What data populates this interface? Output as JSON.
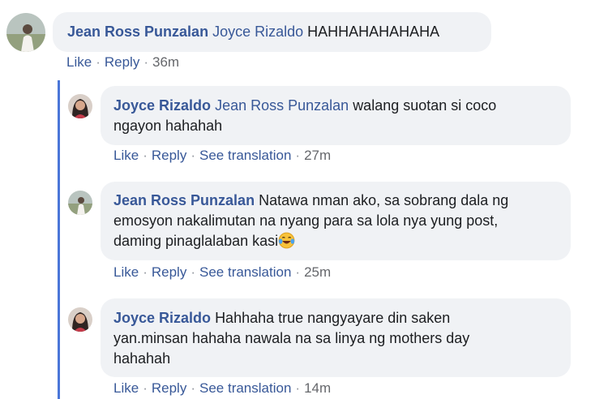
{
  "comments": [
    {
      "author": "Jean Ross Punzalan",
      "mention": "Joyce Rizaldo",
      "lines": [
        "HAHHAHAHAHAHA"
      ],
      "actions": {
        "like": "Like",
        "reply": "Reply",
        "time": "36m"
      }
    },
    {
      "author": "Joyce Rizaldo",
      "mention": "Jean Ross Punzalan",
      "lines": [
        "walang suotan si coco",
        "ngayon hahahah"
      ],
      "actions": {
        "like": "Like",
        "reply": "Reply",
        "translate": "See translation",
        "time": "27m"
      }
    },
    {
      "author": "Jean Ross Punzalan",
      "lines": [
        "Natawa nman ako, sa sobrang dala ng",
        "emosyon nakalimutan na nyang para sa lola nya yung post,",
        "daming pinaglalaban kasi"
      ],
      "actions": {
        "like": "Like",
        "reply": "Reply",
        "translate": "See translation",
        "time": "25m"
      }
    },
    {
      "author": "Joyce Rizaldo",
      "lines": [
        "Hahhaha true nangyayare din saken",
        "yan.minsan hahaha nawala na sa linya ng mothers day",
        "hahahah"
      ],
      "actions": {
        "like": "Like",
        "reply": "Reply",
        "translate": "See translation",
        "time": "14m"
      }
    }
  ],
  "separator": "·",
  "icons": {
    "emoji": "laughing-tears-emoji",
    "avatar_a": "avatar-jean-ross",
    "avatar_b": "avatar-joyce"
  },
  "colors": {
    "link": "#385898",
    "bubble": "#f0f2f5",
    "thread": "#4a76d8",
    "meta": "#65676b"
  }
}
